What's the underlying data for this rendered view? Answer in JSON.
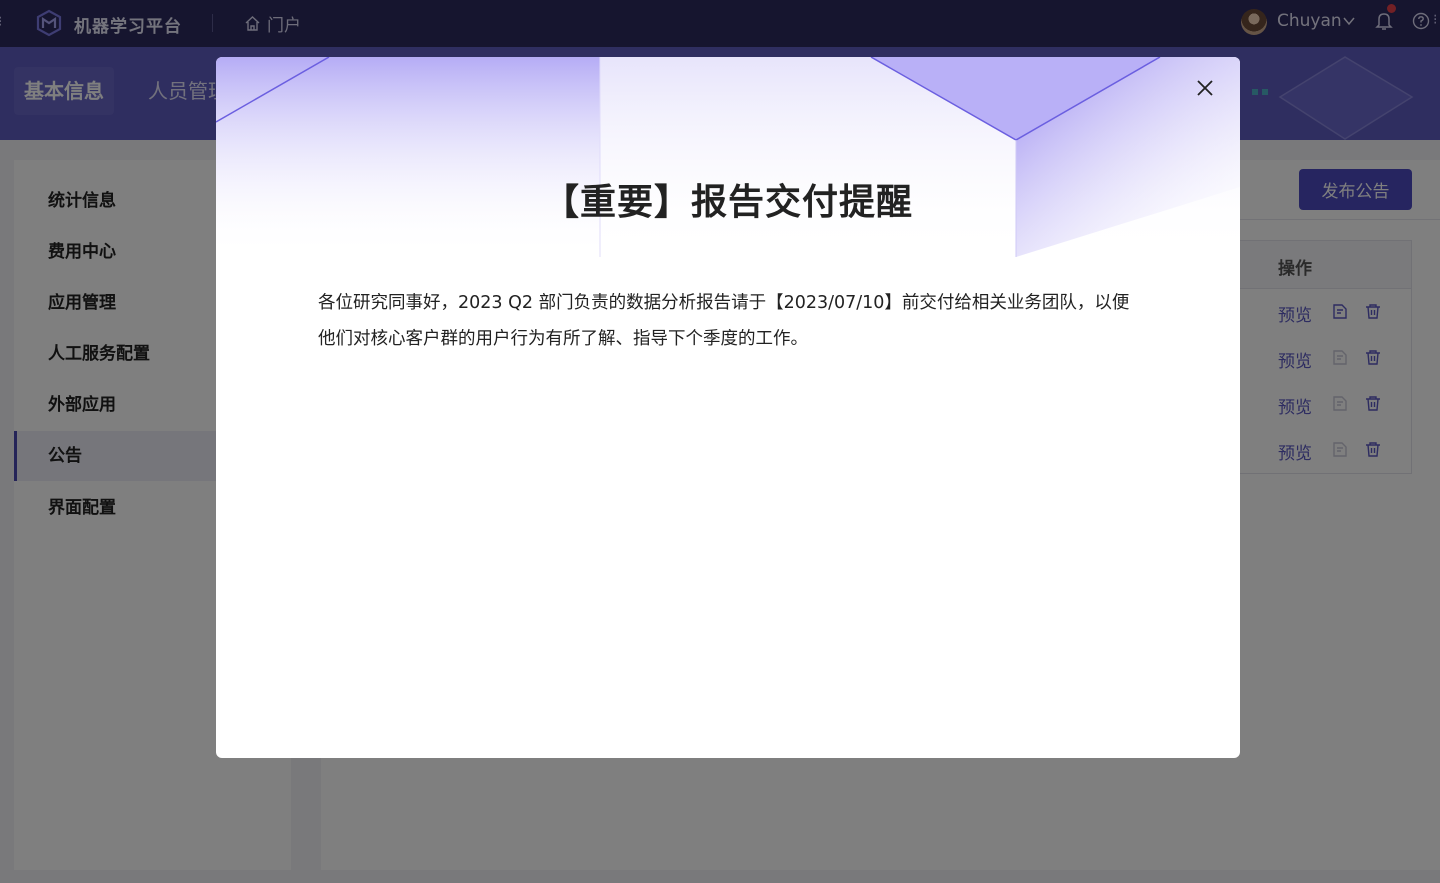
{
  "topbar": {
    "app_title": "机器学习平台",
    "portal_label": "门户",
    "username": "Chuyan"
  },
  "icons": {
    "logo": "logo-icon",
    "portal": "home-icon",
    "user_menu": "chevron-down-icon",
    "notifications": "bell-icon",
    "help": "help-icon",
    "close": "close-icon",
    "edit": "edit-icon",
    "delete": "trash-icon"
  },
  "tabs": [
    {
      "label": "基本信息"
    },
    {
      "label": "人员管理"
    }
  ],
  "sidebar": {
    "items": [
      {
        "label": "统计信息"
      },
      {
        "label": "费用中心"
      },
      {
        "label": "应用管理"
      },
      {
        "label": "人工服务配置"
      },
      {
        "label": "外部应用"
      },
      {
        "label": "公告"
      },
      {
        "label": "界面配置"
      }
    ],
    "active_index": 5
  },
  "main": {
    "publish_label": "发布公告",
    "ops_header": "操作",
    "rows": [
      {
        "preview_label": "预览"
      },
      {
        "preview_label": "预览"
      },
      {
        "preview_label": "预览"
      },
      {
        "preview_label": "预览"
      }
    ]
  },
  "modal": {
    "title": "【重要】报告交付提醒",
    "body": "各位研究同事好，2023 Q2 部门负责的数据分析报告请于【2023/07/10】前交付给相关业务团队，以便他们对核心客户群的用户行为有所了解、指导下个季度的工作。"
  },
  "colors": {
    "topbar_bg": "#2c2a5e",
    "subheader_bg": "#5e5cc0",
    "accent": "#4c4ac0",
    "notification_dot": "#e5404a"
  }
}
